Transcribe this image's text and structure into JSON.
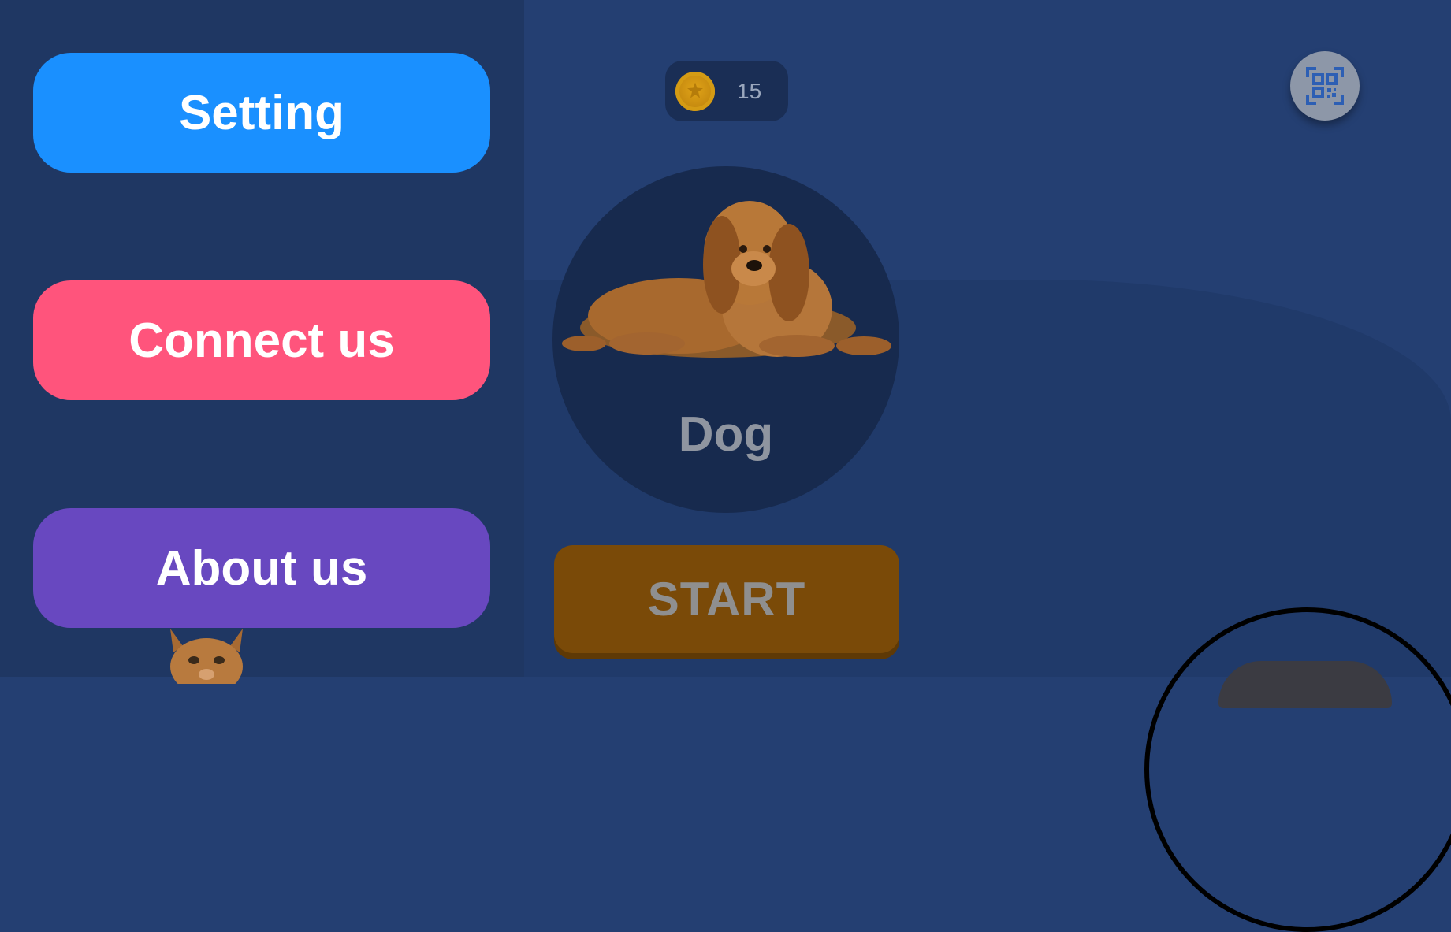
{
  "drawer": {
    "items": [
      {
        "label": "Setting",
        "color": "#1a90ff"
      },
      {
        "label": "Connect us",
        "color": "#ff547c"
      },
      {
        "label": "About us",
        "color": "#6848c0"
      }
    ]
  },
  "header": {
    "coins": "15",
    "coin_icon": "coin-icon",
    "qr_icon": "qr-scan-icon"
  },
  "selection": {
    "animal_name": "Dog",
    "start_label": "START"
  },
  "colors": {
    "background": "#243f72",
    "drawer": "#1f3763",
    "start": "#7a4a08"
  }
}
